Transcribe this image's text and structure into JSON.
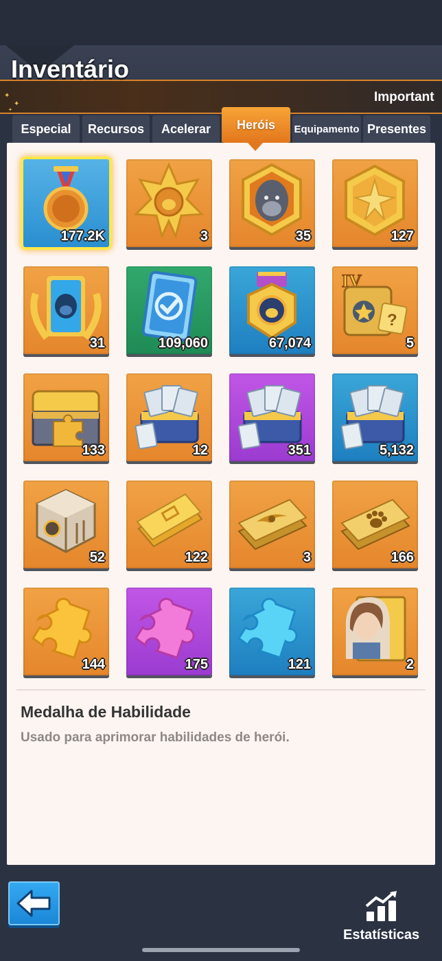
{
  "header": {
    "title": "Inventário",
    "banner_text": "Important"
  },
  "tabs": [
    {
      "label": "Especial"
    },
    {
      "label": "Recursos"
    },
    {
      "label": "Acelerar"
    },
    {
      "label": "Heróis",
      "active": true
    },
    {
      "label": "Equipamento"
    },
    {
      "label": "Presentes"
    }
  ],
  "items": [
    {
      "icon": "skill-medal-icon",
      "count": "177.2K",
      "bg": "#3a9fd8",
      "selected": true
    },
    {
      "icon": "gold-gorilla-badge-icon",
      "count": "3",
      "bg": "#e5862c"
    },
    {
      "icon": "gorilla-portrait-hexagon-icon",
      "count": "35",
      "bg": "#e5862c"
    },
    {
      "icon": "gold-star-hexagon-icon",
      "count": "127",
      "bg": "#e5862c"
    },
    {
      "icon": "laurel-gorilla-card-icon",
      "count": "31",
      "bg": "#e5862c"
    },
    {
      "icon": "blue-checkmark-card-icon",
      "count": "109,060",
      "bg": "#1f8a55"
    },
    {
      "icon": "gorilla-medal-badge-icon",
      "count": "67,074",
      "bg": "#1e7fc0"
    },
    {
      "icon": "level-iv-mystery-chest-icon",
      "count": "5",
      "bg": "#e5862c"
    },
    {
      "icon": "golden-puzzle-chest-icon",
      "count": "133",
      "bg": "#e5862c"
    },
    {
      "icon": "exp-chest-icon",
      "count": "12",
      "bg": "#e5862c"
    },
    {
      "icon": "exp-chest-icon",
      "count": "351",
      "bg": "#9b3bd0"
    },
    {
      "icon": "exp-chest-icon",
      "count": "5,132",
      "bg": "#1e7fc0"
    },
    {
      "icon": "gear-crate-icon",
      "count": "52",
      "bg": "#e5862c"
    },
    {
      "icon": "gold-ticket-icon",
      "count": "122",
      "bg": "#e5862c"
    },
    {
      "icon": "winged-ticket-icon",
      "count": "3",
      "bg": "#e5862c"
    },
    {
      "icon": "paw-ticket-icon",
      "count": "166",
      "bg": "#e5862c"
    },
    {
      "icon": "orange-puzzle-piece-icon",
      "count": "144",
      "bg": "#e5862c"
    },
    {
      "icon": "pink-puzzle-piece-icon",
      "count": "175",
      "bg": "#9b3bd0"
    },
    {
      "icon": "blue-puzzle-piece-icon",
      "count": "121",
      "bg": "#1e7fc0"
    },
    {
      "icon": "hero-portrait-card-icon",
      "count": "2",
      "bg": "#e5862c"
    }
  ],
  "details": {
    "name": "Medalha de Habilidade",
    "description": "Usado para aprimorar habilidades de herói."
  },
  "footer": {
    "back_icon": "back-arrow-icon",
    "stats_icon": "statistics-chart-icon",
    "stats_label": "Estatísticas"
  },
  "colors": {
    "accent_orange": "#e3771d",
    "panel_bg": "#fcf5f2",
    "background": "#2b3242"
  }
}
